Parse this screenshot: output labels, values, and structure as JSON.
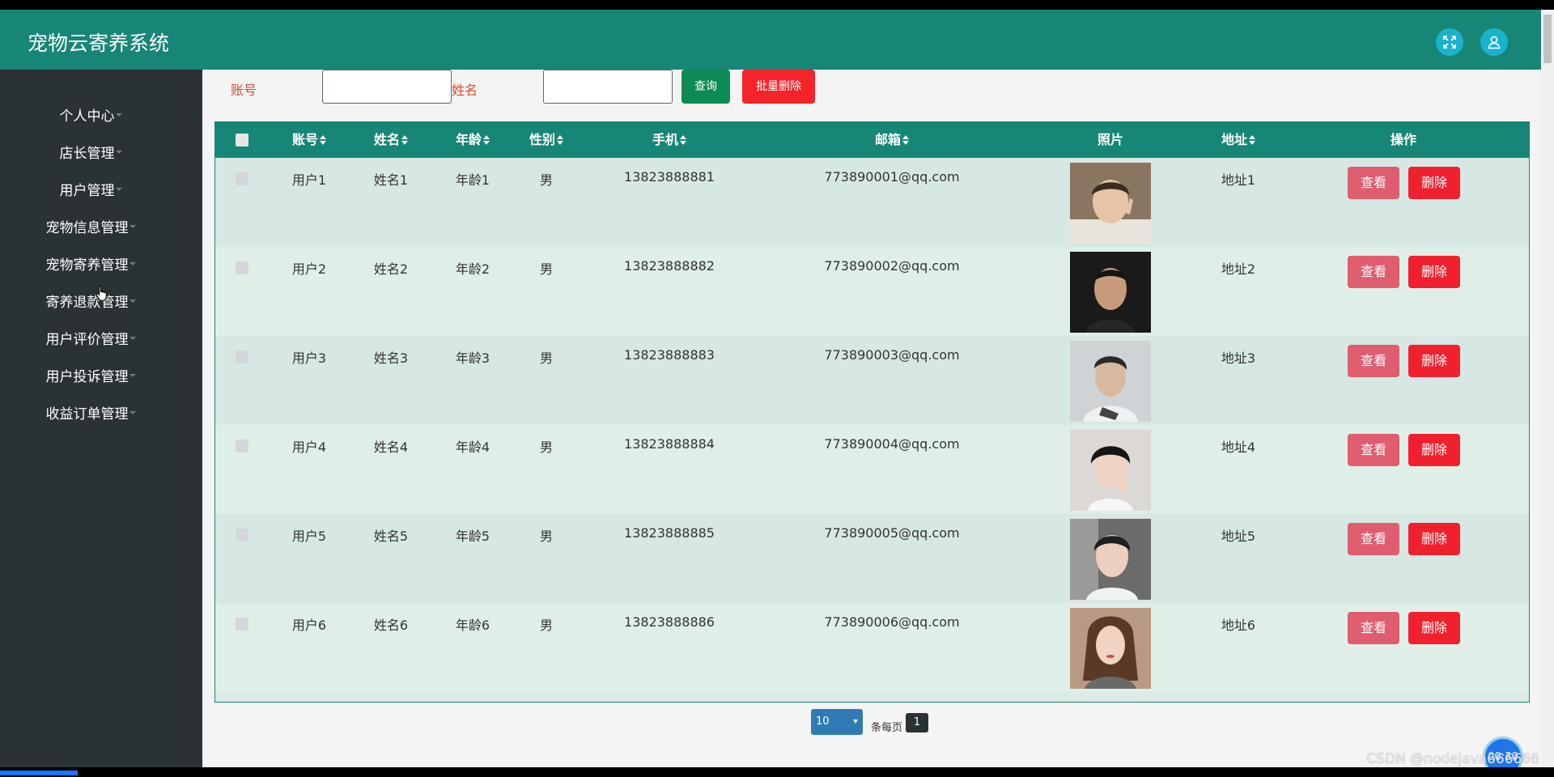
{
  "app": {
    "title": "宠物云寄养系统"
  },
  "header": {
    "fullscreen_icon": "fullscreen-icon",
    "user_icon": "user-icon"
  },
  "sidebar": {
    "items": [
      {
        "label": "个人中心"
      },
      {
        "label": "店长管理"
      },
      {
        "label": "用户管理"
      },
      {
        "label": "宠物信息管理"
      },
      {
        "label": "宠物寄养管理"
      },
      {
        "label": "寄养退款管理"
      },
      {
        "label": "用户评价管理"
      },
      {
        "label": "用户投诉管理"
      },
      {
        "label": "收益订单管理"
      }
    ]
  },
  "search": {
    "account_label": "账号",
    "name_label": "姓名",
    "account_value": "",
    "name_value": "",
    "query_button": "查询",
    "batch_delete_button": "批量删除"
  },
  "table": {
    "columns": [
      "账号",
      "姓名",
      "年龄",
      "性别",
      "手机",
      "邮箱",
      "照片",
      "地址",
      "操作"
    ],
    "rows": [
      {
        "account": "用户1",
        "name": "姓名1",
        "age": "年龄1",
        "gender": "男",
        "phone": "13823888881",
        "email": "773890001@qq.com",
        "address": "地址1",
        "view": "查看",
        "delete": "删除"
      },
      {
        "account": "用户2",
        "name": "姓名2",
        "age": "年龄2",
        "gender": "男",
        "phone": "13823888882",
        "email": "773890002@qq.com",
        "address": "地址2",
        "view": "查看",
        "delete": "删除"
      },
      {
        "account": "用户3",
        "name": "姓名3",
        "age": "年龄3",
        "gender": "男",
        "phone": "13823888883",
        "email": "773890003@qq.com",
        "address": "地址3",
        "view": "查看",
        "delete": "删除"
      },
      {
        "account": "用户4",
        "name": "姓名4",
        "age": "年龄4",
        "gender": "男",
        "phone": "13823888884",
        "email": "773890004@qq.com",
        "address": "地址4",
        "view": "查看",
        "delete": "删除"
      },
      {
        "account": "用户5",
        "name": "姓名5",
        "age": "年龄5",
        "gender": "男",
        "phone": "13823888885",
        "email": "773890005@qq.com",
        "address": "地址5",
        "view": "查看",
        "delete": "删除"
      },
      {
        "account": "用户6",
        "name": "姓名6",
        "age": "年龄6",
        "gender": "男",
        "phone": "13823888886",
        "email": "773890006@qq.com",
        "address": "地址6",
        "view": "查看",
        "delete": "删除"
      }
    ]
  },
  "pager": {
    "page_size": "10",
    "per_page_label": "条每页",
    "current_page": "1"
  },
  "overlay": {
    "watermark": "CSDN @nodejava666666",
    "timer": "00:30"
  },
  "colors": {
    "header": "#178676",
    "sidebar": "#2b3236",
    "danger": "#f0202e",
    "view": "#e05d6f",
    "query": "#0e8a54"
  }
}
